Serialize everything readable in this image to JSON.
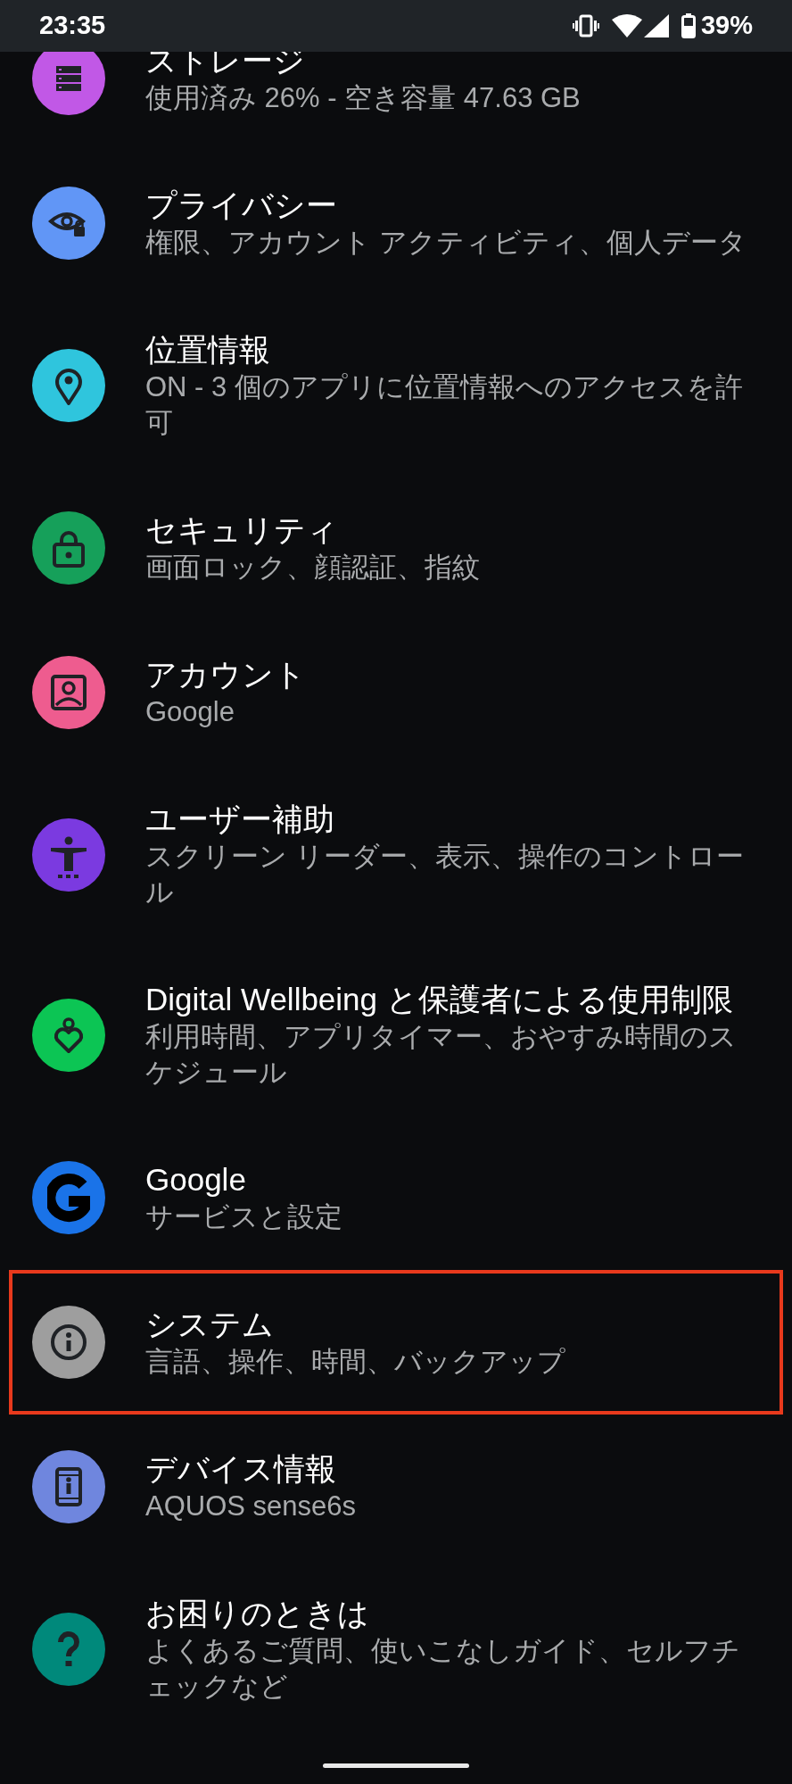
{
  "status_bar": {
    "time": "23:35",
    "battery_percent": "39%"
  },
  "settings": [
    {
      "title": "ストレージ",
      "subtitle": "使用済み 26% - 空き容量 47.63 GB",
      "color": "#c158e6",
      "highlighted": false
    },
    {
      "title": "プライバシー",
      "subtitle": "権限、アカウント アクティビティ、個人データ",
      "color": "#6196f6",
      "highlighted": false
    },
    {
      "title": "位置情報",
      "subtitle": "ON - 3 個のアプリに位置情報へのアクセスを許可",
      "color": "#2fc5dd",
      "highlighted": false
    },
    {
      "title": "セキュリティ",
      "subtitle": "画面ロック、顔認証、指紋",
      "color": "#16a05a",
      "highlighted": false
    },
    {
      "title": "アカウント",
      "subtitle": "Google",
      "color": "#ee5c8f",
      "highlighted": false
    },
    {
      "title": "ユーザー補助",
      "subtitle": "スクリーン リーダー、表示、操作のコントロール",
      "color": "#7b3ae0",
      "highlighted": false
    },
    {
      "title": "Digital Wellbeing と保護者による使用制限",
      "subtitle": "利用時間、アプリタイマー、おやすみ時間のスケジュール",
      "color": "#0cc554",
      "highlighted": false
    },
    {
      "title": "Google",
      "subtitle": "サービスと設定",
      "color": "#1a73e8",
      "highlighted": false
    },
    {
      "title": "システム",
      "subtitle": "言語、操作、時間、バックアップ",
      "color": "#9e9e9e",
      "highlighted": true
    },
    {
      "title": "デバイス情報",
      "subtitle": "AQUOS sense6s",
      "color": "#6f86de",
      "highlighted": false
    },
    {
      "title": "お困りのときは",
      "subtitle": "よくあるご質問、使いこなしガイド、セルフチェックなど",
      "color": "#00897b",
      "highlighted": false
    }
  ]
}
